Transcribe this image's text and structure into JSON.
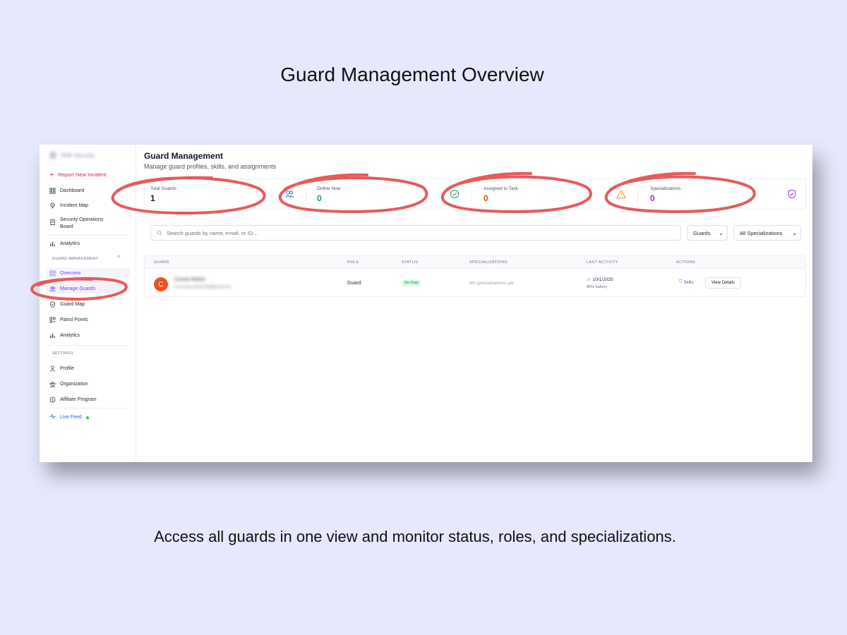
{
  "headline": "Guard Management Overview",
  "caption": "Access all guards in one view and monitor status, roles, and specializations.",
  "sidebar": {
    "brand": "RNK Security",
    "report_label": "Report New Incident",
    "items": [
      {
        "label": "Dashboard",
        "icon": "grid-icon"
      },
      {
        "label": "Incident Map",
        "icon": "pin-icon"
      },
      {
        "label": "Security Operations Board",
        "icon": "clipboard-icon"
      },
      {
        "label": "Analytics",
        "icon": "bar-chart-icon"
      }
    ],
    "guard_section": "GUARD MANAGEMENT",
    "guard_items": [
      {
        "label": "Overview",
        "icon": "grid-icon"
      },
      {
        "label": "Manage Guards",
        "icon": "users-icon"
      },
      {
        "label": "Guard Map",
        "icon": "shield-icon"
      },
      {
        "label": "Patrol Points",
        "icon": "qr-icon"
      },
      {
        "label": "Analytics",
        "icon": "bar-chart-icon"
      }
    ],
    "settings_section": "SETTINGS",
    "settings_items": [
      {
        "label": "Profile",
        "icon": "user-icon"
      },
      {
        "label": "Organization",
        "icon": "building-icon"
      },
      {
        "label": "Affiliate Program",
        "icon": "dollar-icon"
      }
    ],
    "live_feed": "Live Feed"
  },
  "main": {
    "title": "Guard Management",
    "subtitle": "Manage guard profiles, skills, and assignments",
    "stats": [
      {
        "label": "Total Guards",
        "value": "1",
        "color": "#111827"
      },
      {
        "label": "Online Now",
        "value": "0",
        "color": "#16a34a"
      },
      {
        "label": "Assigned to Task",
        "value": "0",
        "color": "#ea580c"
      },
      {
        "label": "Specializations",
        "value": "0",
        "color": "#9333ea"
      }
    ],
    "search_placeholder": "Search guards by name, email, or ID...",
    "filter_role": "Guards",
    "filter_spec": "All Specializations",
    "columns": [
      "GUARD",
      "ROLE",
      "STATUS",
      "SPECIALIZATIONS",
      "LAST ACTIVITY",
      "ACTIONS"
    ],
    "rows": [
      {
        "initial": "C",
        "name": "Connie Bolton",
        "email": "c1conniecookiee239@gmail.com",
        "role": "Guard",
        "status": "On Duty",
        "specializations": "No specializations yet",
        "last_activity": "10/1/2025",
        "battery": "85% battery",
        "skills_label": "Skills",
        "view_label": "View Details"
      }
    ]
  },
  "colors": {
    "annotation_red": "#e85a5a",
    "accent_purple": "#7c3aed",
    "report_red": "#e11d48"
  }
}
